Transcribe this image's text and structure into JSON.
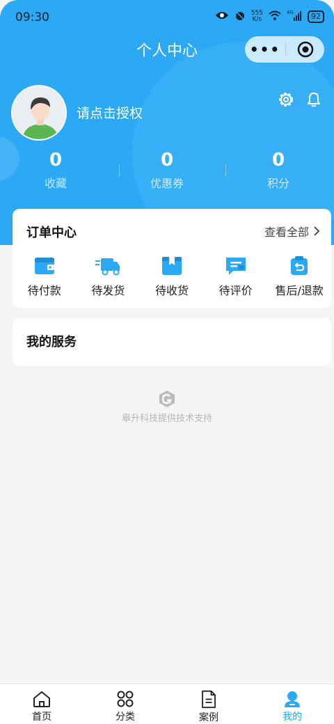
{
  "status_bar": {
    "time": "09:30",
    "net_speed_value": "555",
    "net_speed_unit": "K/s",
    "network": "4G",
    "battery": "92"
  },
  "navbar": {
    "title": "个人中心",
    "capsule_more": "•••"
  },
  "profile": {
    "auth_prompt": "请点击授权"
  },
  "stats": [
    {
      "value": "0",
      "label": "收藏"
    },
    {
      "value": "0",
      "label": "优惠券"
    },
    {
      "value": "0",
      "label": "积分"
    }
  ],
  "orders": {
    "title": "订单中心",
    "view_all": "查看全部",
    "items": [
      {
        "label": "待付款",
        "icon": "wallet-icon"
      },
      {
        "label": "待发货",
        "icon": "delivery-truck-icon"
      },
      {
        "label": "待收货",
        "icon": "package-box-icon"
      },
      {
        "label": "待评价",
        "icon": "comment-icon"
      },
      {
        "label": "售后/退款",
        "icon": "refund-icon"
      }
    ]
  },
  "services": {
    "title": "我的服务"
  },
  "support": {
    "text": "皋升科技提供技术支持"
  },
  "tabbar": {
    "items": [
      {
        "label": "首页",
        "icon": "home-icon"
      },
      {
        "label": "分类",
        "icon": "grid-icon"
      },
      {
        "label": "案例",
        "icon": "document-icon"
      },
      {
        "label": "我的",
        "icon": "user-icon",
        "active": true
      }
    ]
  },
  "colors": {
    "primary": "#2ba9f5",
    "background": "#f5f5f5",
    "avatar_shirt": "#5ab552"
  }
}
